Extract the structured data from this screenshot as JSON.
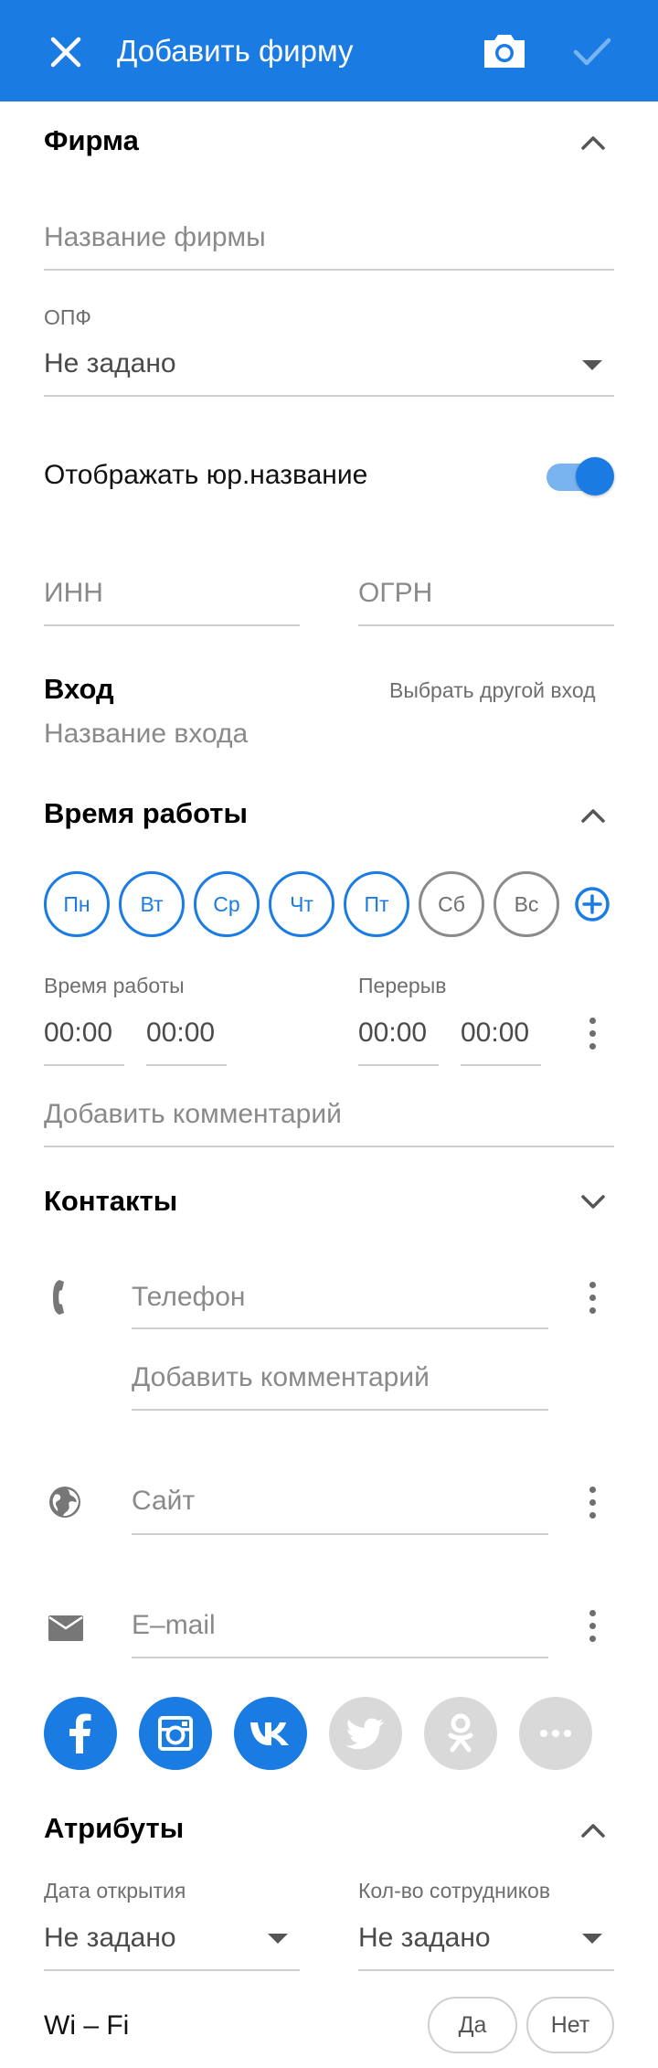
{
  "appbar": {
    "title": "Добавить фирму"
  },
  "firm": {
    "section_title": "Фирма",
    "name_placeholder": "Название фирмы",
    "opf_label": "ОПФ",
    "opf_value": "Не задано",
    "show_legal_name_label": "Отображать юр.название",
    "show_legal_name_on": true,
    "inn_placeholder": "ИНН",
    "ogrn_placeholder": "ОГРН"
  },
  "entrance": {
    "section_title": "Вход",
    "choose_other_label": "Выбрать другой вход",
    "name_placeholder": "Название входа"
  },
  "hours": {
    "section_title": "Время работы",
    "days": [
      {
        "label": "Пн",
        "active": true
      },
      {
        "label": "Вт",
        "active": true
      },
      {
        "label": "Ср",
        "active": true
      },
      {
        "label": "Чт",
        "active": true
      },
      {
        "label": "Пт",
        "active": true
      },
      {
        "label": "Сб",
        "active": false
      },
      {
        "label": "Вс",
        "active": false
      }
    ],
    "work_label": "Время работы",
    "break_label": "Перерыв",
    "work_from": "00:00",
    "work_to": "00:00",
    "break_from": "00:00",
    "break_to": "00:00",
    "comment_placeholder": "Добавить комментарий"
  },
  "contacts": {
    "section_title": "Контакты",
    "phone_placeholder": "Телефон",
    "phone_comment_placeholder": "Добавить комментарий",
    "site_placeholder": "Сайт",
    "email_placeholder": "E–mail",
    "socials": [
      {
        "icon": "facebook-icon",
        "active": true
      },
      {
        "icon": "instagram-icon",
        "active": true
      },
      {
        "icon": "vk-icon",
        "active": true
      },
      {
        "icon": "twitter-icon",
        "active": false
      },
      {
        "icon": "odnoklassniki-icon",
        "active": false
      },
      {
        "icon": "more-horizontal-icon",
        "active": false
      }
    ]
  },
  "attributes": {
    "section_title": "Атрибуты",
    "open_date_label": "Дата открытия",
    "open_date_value": "Не задано",
    "employees_label": "Кол-во сотрудников",
    "employees_value": "Не задано",
    "wifi_label": "Wi – Fi",
    "yes_label": "Да",
    "no_label": "Нет"
  },
  "colors": {
    "accent": "#1a7ce3",
    "accent_light": "#7ab4f0",
    "inactive": "#d9d9d9"
  }
}
